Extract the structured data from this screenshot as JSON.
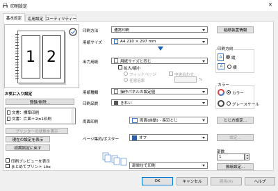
{
  "window": {
    "title": "印刷設定",
    "close_glyph": "✕"
  },
  "tabs": [
    {
      "label": "基本設定"
    },
    {
      "label": "応用設定"
    },
    {
      "label": "ユーティリティー"
    }
  ],
  "preview": {
    "page1": "1",
    "page2": "2"
  },
  "favorites": {
    "label": "お気に入り設定",
    "register_button": "登録/削除...",
    "items": [
      {
        "label": "文書：標準印刷"
      },
      {
        "label": "文書：片面＋2in1印刷"
      }
    ]
  },
  "left_buttons": {
    "printer_status": "プリンターの状態を表示",
    "show_current": "現在の設定を表示",
    "reset": "初期設定に戻す"
  },
  "left_checks": {
    "print_preview": "印刷プレビューを表示",
    "batch_print": "まとめてプリント Lite"
  },
  "print_method": {
    "label": "印刷方法",
    "value": "通常印刷",
    "button": "給紙装置情報"
  },
  "paper_size": {
    "label": "用紙サイズ",
    "value": "A4 210 × 297 mm"
  },
  "output_size": {
    "label": "出力用紙",
    "value": "用紙サイズと同じ",
    "scale_label": "拡大/縮小",
    "fit_label": "フィットページ",
    "center_label": "中央合わせ",
    "custom_label": "任意倍率",
    "percent": "%"
  },
  "orientation": {
    "label": "印刷方向",
    "portrait": "縦",
    "landscape": "横",
    "portrait_icon": "A",
    "landscape_icon": "A"
  },
  "paper_type": {
    "label": "用紙種類",
    "value": "操作パネルの設定値"
  },
  "quality": {
    "label": "印刷品質",
    "value": "きれい"
  },
  "color": {
    "label": "カラー",
    "color_option": "カラー",
    "gray_option": "グレースケール"
  },
  "duplex": {
    "label": "両面印刷",
    "value": "両面(自動) - 長辺とじ",
    "button": "とじ方設定..."
  },
  "nup": {
    "label": "ページ集約/ポスター",
    "value": "オフ",
    "button": "設定..."
  },
  "copies": {
    "label": "部数",
    "value": "1",
    "collate_value": "部単位で印刷",
    "staple_button": "排紙設定..."
  },
  "footer": {
    "ok": "OK",
    "cancel": "キャンセル",
    "apply": "適用(A)",
    "help": "ヘルプ"
  }
}
